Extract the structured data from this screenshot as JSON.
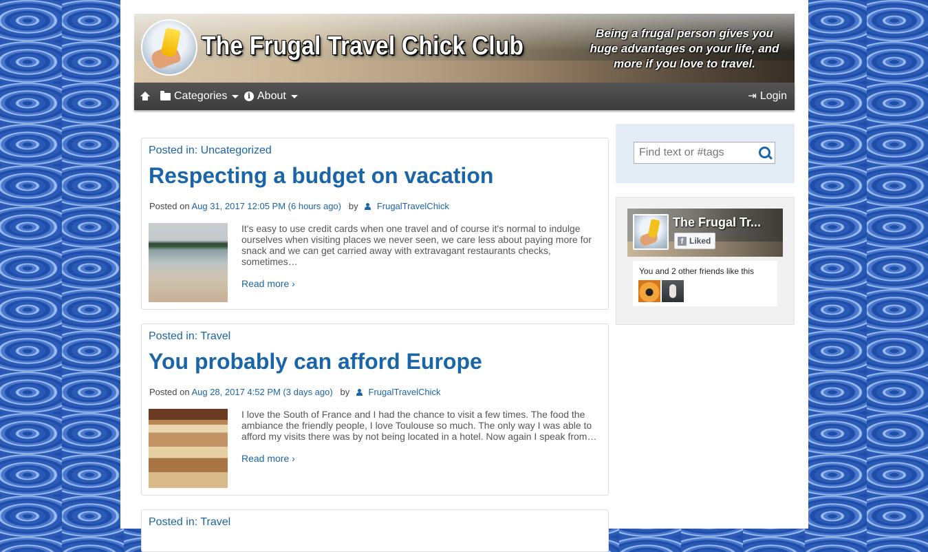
{
  "site": {
    "title": "The Frugal Travel Chick Club",
    "tagline": "Being a frugal person gives you huge advantages on your life, and more if you love to travel."
  },
  "nav": {
    "home_icon": "home-icon",
    "categories_label": "Categories",
    "about_label": "About",
    "login_label": "Login"
  },
  "posts": [
    {
      "category": "Posted in: Uncategorized",
      "title": "Respecting a budget on vacation",
      "posted_on": "Posted on",
      "date": "Aug 31, 2017 12:05 PM (6 hours ago)",
      "by": "by",
      "author": "FrugalTravelChick",
      "excerpt": "It's easy to use credit cards when one travel and of course it's normal to indulge ourselves when visiting places we never seen, we care less about paying more for snack and we can get carried away with extravagant restaurants checks, sometimes…",
      "read_more": "Read more ›"
    },
    {
      "category": "Posted in: Travel",
      "title": "You probably can afford Europe",
      "posted_on": "Posted on",
      "date": "Aug 28, 2017 4:52 PM (3 days ago)",
      "by": "by",
      "author": "FrugalTravelChick",
      "excerpt": "I love the South of France and I had the chance to visit a few times. The food the ambiance the friendly people, I love Toulouse so much. The only way I was able to afford my visits there was by not being located in a hotel. Now again I speak from…",
      "read_more": "Read more ›"
    },
    {
      "category": "Posted in: Travel"
    }
  ],
  "sidebar": {
    "search_placeholder": "Find text or #tags",
    "facebook": {
      "page_name": "The Frugal Tr...",
      "liked_label": "Liked",
      "friends_text": "You and 2 other friends like this"
    }
  },
  "colors": {
    "link": "#1a64a8",
    "navbar": "#444444",
    "search_panel": "#e3ecf5"
  }
}
